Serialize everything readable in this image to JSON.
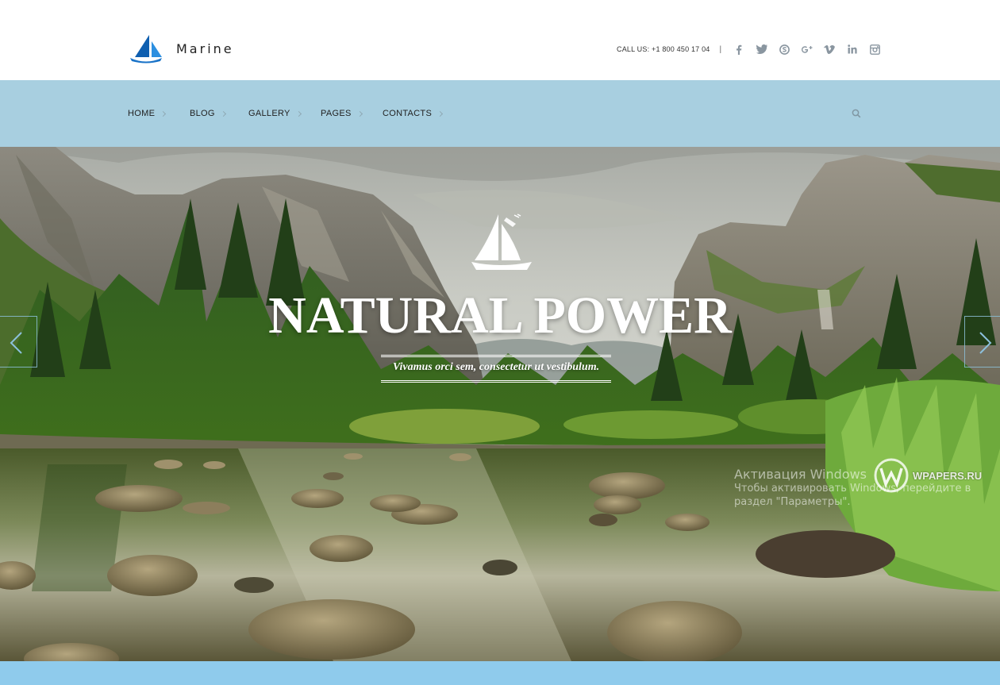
{
  "site": {
    "logo_text": "Marine",
    "phone": "CALL US: +1 800 450 17 04",
    "separator": "|",
    "social_icons": [
      "facebook-icon",
      "twitter-icon",
      "skype-icon",
      "google-plus-icon",
      "vimeo-icon",
      "linkedin-icon",
      "instagram-icon"
    ]
  },
  "nav": {
    "items": [
      {
        "label": "HOME"
      },
      {
        "label": "BLOG"
      },
      {
        "label": "GALLERY"
      },
      {
        "label": "PAGES"
      },
      {
        "label": "CONTACTS"
      }
    ],
    "search_icon": "search-icon"
  },
  "hero": {
    "title": "NATURAL POWER",
    "subtitle": "Vivamus orci sem, consectetur ut vestibulum.",
    "prev_icon": "chevron-left-icon",
    "next_icon": "chevron-right-icon"
  },
  "watermark": {
    "title": "Активация Windows",
    "line1": "Чтобы активировать Windows, перейдите в",
    "line2": "раздел \"Параметры\".",
    "badge": "WPAPERS.RU"
  },
  "colors": {
    "nav_bg": "#a8cfe0",
    "accent_blue": "#1a73c8",
    "bottom_strip": "#8fcbec"
  }
}
